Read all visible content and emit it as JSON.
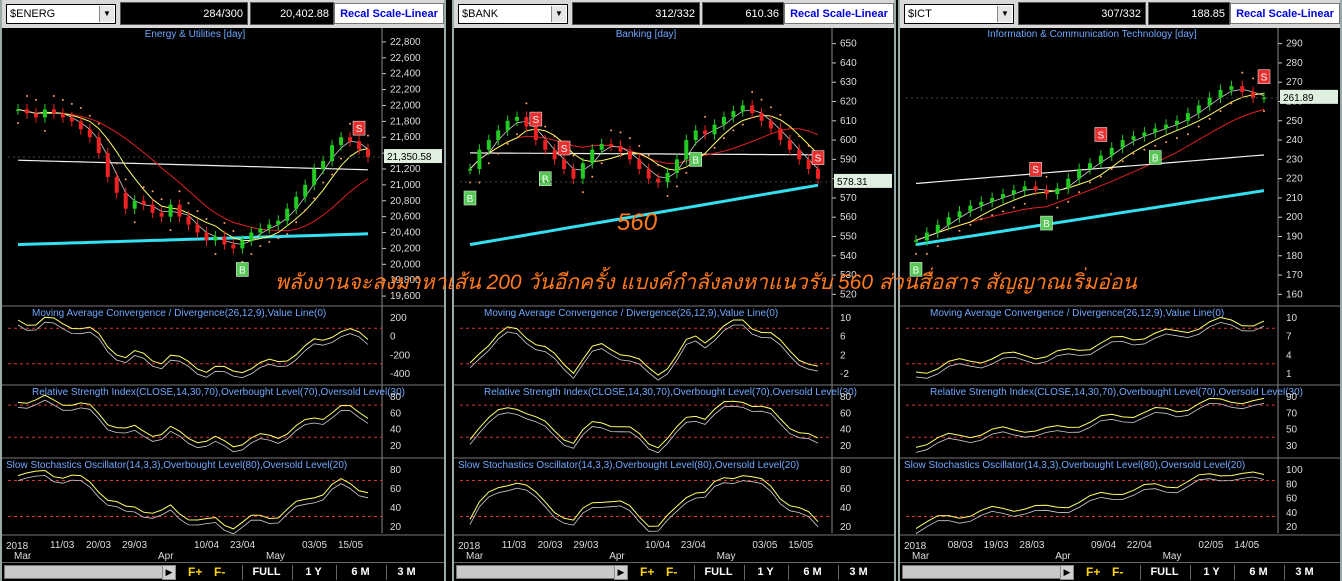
{
  "panels": [
    {
      "symbol": "$ENERG",
      "count": "284/300",
      "last": "20,402.88",
      "recal": "Recal Scale-Linear",
      "title": "Energy & Utilities [day]",
      "price_tag": "21,350.58",
      "macd_label": "Moving Average Convergence / Divergence(26,12,9),Value Line(0)",
      "rsi_label": "Relative Strength Index(CLOSE,14,30,70),Overbought Level(70),Oversold Level(30)",
      "sto_label": "Slow Stochastics Oscillator(14,3,3),Overbought Level(80),Oversold Level(20)",
      "date_year": "2018",
      "date_labels": [
        "Mar",
        "11/03",
        "20/03",
        "29/03",
        "Apr",
        "10/04",
        "23/04",
        "May",
        "03/05",
        "15/05"
      ]
    },
    {
      "symbol": "$BANK",
      "count": "312/332",
      "last": "610.36",
      "recal": "Recal Scale-Linear",
      "title": "Banking [day]",
      "price_tag": "578.31",
      "macd_label": "Moving Average Convergence / Divergence(26,12,9),Value Line(0)",
      "rsi_label": "Relative Strength Index(CLOSE,14,30,70),Overbought Level(70),Oversold Level(30)",
      "sto_label": "Slow Stochastics Oscillator(14,3,3),Overbought Level(80),Oversold Level(20)",
      "date_year": "2018",
      "date_labels": [
        "Mar",
        "11/03",
        "20/03",
        "29/03",
        "Apr",
        "10/04",
        "23/04",
        "May",
        "03/05",
        "15/05"
      ]
    },
    {
      "symbol": "$ICT",
      "count": "307/332",
      "last": "188.85",
      "recal": "Recal Scale-Linear",
      "title": "Information & Communication Technology [day]",
      "price_tag": "261.89",
      "macd_label": "Moving Average Convergence / Divergence(26,12,9),Value Line(0)",
      "rsi_label": "Relative Strength Index(CLOSE,14,30,70),Overbought Level(70),Oversold Level(30)",
      "sto_label": "Slow Stochastics Oscillator(14,3,3),Overbought Level(80),Oversold Level(20)",
      "date_year": "2018",
      "date_labels": [
        "Mar",
        "08/03",
        "19/03",
        "28/03",
        "Apr",
        "09/04",
        "22/04",
        "May",
        "02/05",
        "14/05"
      ]
    }
  ],
  "toolbar": {
    "f_plus": "F+",
    "f_minus": "F-",
    "full": "FULL",
    "y1": "1 Y",
    "m6": "6 M",
    "m3": "3 M"
  },
  "annotation": {
    "overlay_text": "พลังงานจะลงมาหาเส้น 200 วันอีกครั้ง แบงค์กำลังลงหาแนวรับ 560 ส่วนสื่อสาร สัญญาณเริ่มอ่อน",
    "level_text": "560"
  },
  "chart_data": [
    {
      "type": "candlestick",
      "title": "Energy & Utilities [day]",
      "price_ticks": [
        22800,
        22600,
        22400,
        22200,
        22000,
        21800,
        21600,
        21400,
        21200,
        21000,
        20800,
        20600,
        20400,
        20200,
        20000,
        19800,
        19600
      ],
      "ylim": [
        19500,
        22900
      ],
      "last_price": 21350.58,
      "close": [
        21950,
        21900,
        21850,
        21950,
        21900,
        21850,
        21800,
        21700,
        21600,
        21400,
        21100,
        20900,
        20700,
        20800,
        20750,
        20650,
        20600,
        20750,
        20600,
        20500,
        20400,
        20300,
        20350,
        20250,
        20200,
        20300,
        20400,
        20450,
        20500,
        20550,
        20700,
        20850,
        21000,
        21200,
        21300,
        21500,
        21600,
        21550,
        21450,
        21350
      ],
      "signals": [
        {
          "type": "B",
          "index": 25
        },
        {
          "type": "S",
          "index": 38
        }
      ],
      "macd_ticks": [
        200,
        0,
        -200,
        -400
      ],
      "rsi_ticks": [
        80,
        60,
        40,
        20
      ],
      "sto_ticks": [
        80,
        60,
        40,
        20
      ]
    },
    {
      "type": "candlestick",
      "title": "Banking [day]",
      "price_ticks": [
        650,
        640,
        630,
        620,
        610,
        600,
        590,
        580,
        570,
        560,
        550,
        540,
        530,
        520
      ],
      "ylim": [
        515,
        655
      ],
      "last_price": 578.31,
      "support_level": 560,
      "close": [
        585,
        595,
        600,
        605,
        610,
        612,
        607,
        600,
        595,
        590,
        585,
        580,
        588,
        595,
        598,
        597,
        594,
        590,
        585,
        580,
        578,
        583,
        590,
        600,
        605,
        603,
        608,
        612,
        615,
        618,
        614,
        610,
        606,
        600,
        595,
        590,
        585,
        580
      ],
      "signals": [
        {
          "type": "B",
          "index": 0
        },
        {
          "type": "S",
          "index": 7
        },
        {
          "type": "B",
          "index": 8
        },
        {
          "type": "S",
          "index": 10
        },
        {
          "type": "B",
          "index": 24
        },
        {
          "type": "S",
          "index": 39
        }
      ],
      "macd_ticks": [
        10,
        6,
        2,
        -2
      ],
      "rsi_ticks": [
        80,
        60,
        40,
        20
      ],
      "sto_ticks": [
        80,
        60,
        40,
        20
      ]
    },
    {
      "type": "candlestick",
      "title": "Information & Communication Technology [day]",
      "price_ticks": [
        290,
        280,
        270,
        260,
        250,
        240,
        230,
        220,
        210,
        200,
        190,
        180,
        170,
        160
      ],
      "ylim": [
        155,
        295
      ],
      "last_price": 261.89,
      "close": [
        188,
        192,
        196,
        200,
        203,
        206,
        208,
        210,
        212,
        214,
        216,
        214,
        212,
        215,
        220,
        225,
        228,
        232,
        236,
        240,
        242,
        244,
        246,
        248,
        250,
        254,
        258,
        262,
        266,
        268,
        265,
        262,
        262
      ],
      "signals": [
        {
          "type": "B",
          "index": 0
        },
        {
          "type": "S",
          "index": 11
        },
        {
          "type": "B",
          "index": 12
        },
        {
          "type": "S",
          "index": 17
        },
        {
          "type": "B",
          "index": 22
        },
        {
          "type": "S",
          "index": 37
        }
      ],
      "macd_ticks": [
        10,
        7,
        4,
        1
      ],
      "rsi_ticks": [
        90,
        70,
        50,
        30
      ],
      "sto_ticks": [
        100,
        80,
        60,
        40,
        20
      ]
    }
  ]
}
